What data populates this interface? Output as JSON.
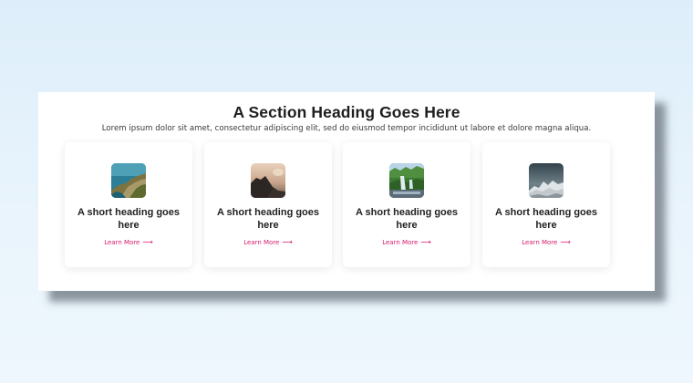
{
  "section": {
    "heading": "A Section Heading Goes Here",
    "subtext": "Lorem ipsum dolor sit amet, consectetur adipiscing elit, sed do eiusmod tempor incididunt ut labore et dolore magna aliqua."
  },
  "cards": [
    {
      "title": "A short heading goes here",
      "link_label": "Learn More",
      "icon": "arrow-right-icon",
      "image": "coastal-cliffs-photo"
    },
    {
      "title": "A short heading goes here",
      "link_label": "Learn More",
      "icon": "arrow-right-icon",
      "image": "sunset-rocks-photo"
    },
    {
      "title": "A short heading goes here",
      "link_label": "Learn More",
      "icon": "arrow-right-icon",
      "image": "forest-waterfall-photo"
    },
    {
      "title": "A short heading goes here",
      "link_label": "Learn More",
      "icon": "arrow-right-icon",
      "image": "snowy-peaks-photo"
    }
  ],
  "colors": {
    "accent": "#d6196e",
    "heading": "#1e1e1e",
    "card_background": "#ffffff"
  }
}
